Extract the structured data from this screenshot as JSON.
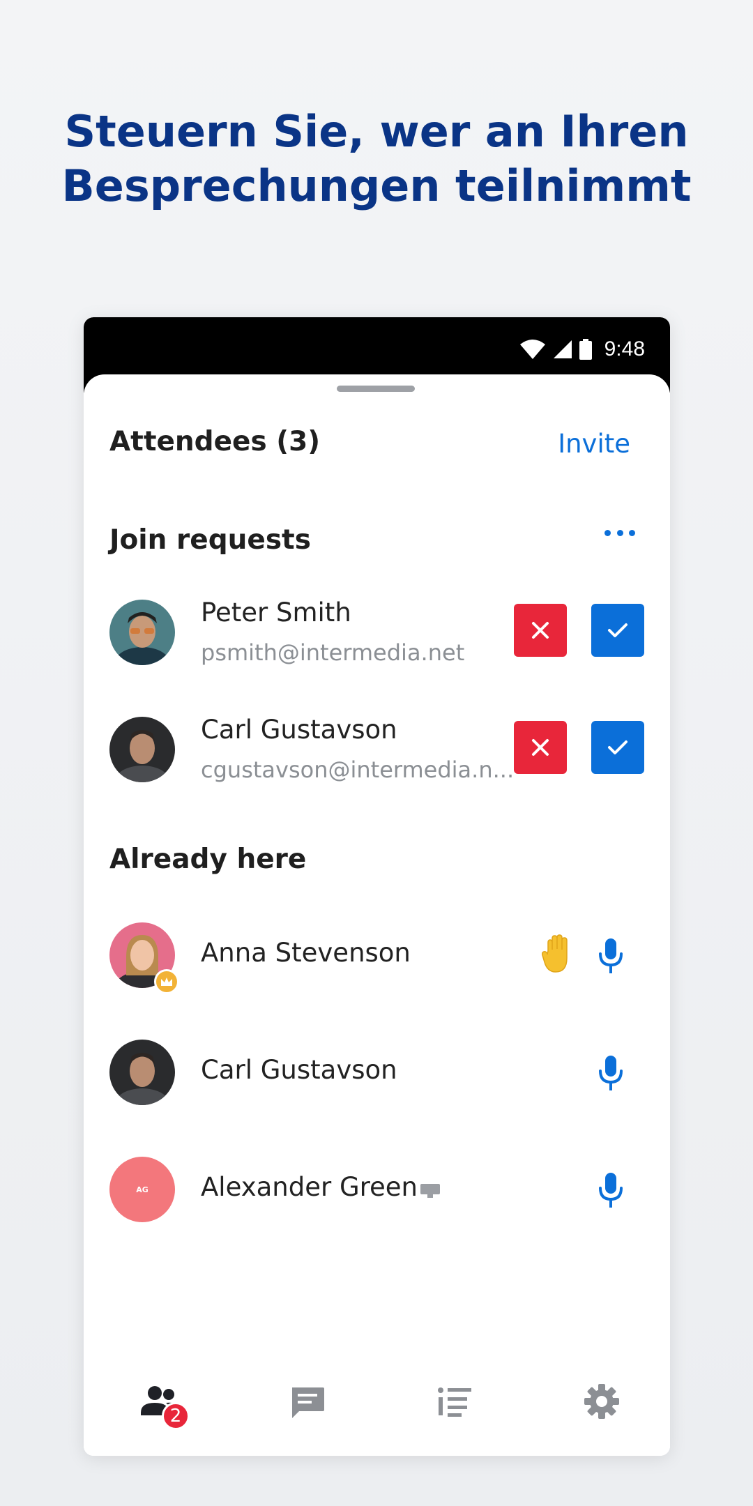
{
  "promo": {
    "headline_line1": "Steuern Sie, wer an Ihren",
    "headline_line2": "Besprechungen teilnimmt"
  },
  "statusbar": {
    "time": "9:48"
  },
  "header": {
    "title": "Attendees (3)",
    "invite_label": "Invite"
  },
  "join_requests": {
    "title": "Join requests",
    "items": [
      {
        "name": "Peter Smith",
        "email": "psmith@intermedia.net"
      },
      {
        "name": "Carl Gustavson",
        "email": "cgustavson@intermedia.n..."
      }
    ]
  },
  "already_here": {
    "title": "Already here",
    "items": [
      {
        "name": "Anna Stevenson",
        "role": "host",
        "hand_raised": true
      },
      {
        "name": "Carl Gustavson"
      },
      {
        "name": "Alexander Green",
        "initials": "AG",
        "screen_sharing": true
      }
    ]
  },
  "bottom_nav": {
    "items": [
      {
        "icon": "people-icon",
        "badge": "2"
      },
      {
        "icon": "chat-icon"
      },
      {
        "icon": "agenda-list-icon"
      },
      {
        "icon": "gear-icon"
      }
    ]
  },
  "colors": {
    "headline": "#0a3486",
    "accent": "#0b6fd9",
    "decline": "#e8263a",
    "hand": "#f5c02e",
    "avatar_ag": "#f3777c"
  }
}
